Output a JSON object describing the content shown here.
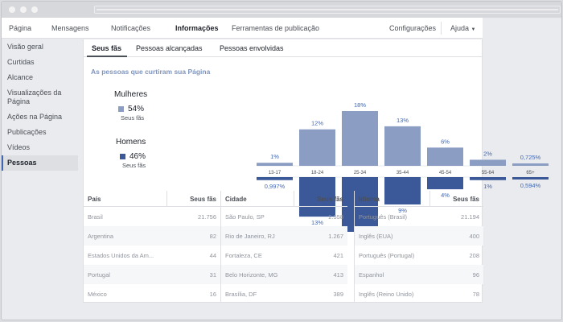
{
  "nav": {
    "items": [
      "Página",
      "Mensagens",
      "Notificações",
      "Informações",
      "Ferramentas de publicação"
    ],
    "settings": "Configurações",
    "help": "Ajuda",
    "help_caret": "▼"
  },
  "sidebar": {
    "items": [
      "Visão geral",
      "Curtidas",
      "Alcance",
      "Visualizações da Página",
      "Ações na Página",
      "Publicações",
      "Vídeos",
      "Pessoas"
    ]
  },
  "subtabs": [
    "Seus fãs",
    "Pessoas alcançadas",
    "Pessoas envolvidas"
  ],
  "subtitle": "As pessoas que curtiram sua Página",
  "legend": {
    "women": {
      "label": "Mulheres",
      "pct": "54%",
      "sub": "Seus fãs"
    },
    "men": {
      "label": "Homens",
      "pct": "46%",
      "sub": "Seus fãs"
    }
  },
  "colors": {
    "women": "#8b9dc3",
    "men": "#3b5998",
    "accent": "#4267b2"
  },
  "chart_data": {
    "type": "bar",
    "categories": [
      "13-17",
      "18-24",
      "25-34",
      "35-44",
      "45-54",
      "55-64",
      "65+"
    ],
    "series": [
      {
        "name": "Mulheres",
        "values": [
          1,
          12,
          18,
          13,
          6,
          2,
          0.725
        ],
        "labels": [
          "1%",
          "12%",
          "18%",
          "13%",
          "6%",
          "2%",
          "0,725%"
        ]
      },
      {
        "name": "Homens",
        "values": [
          0.997,
          13,
          18,
          9,
          4,
          1,
          0.594
        ],
        "labels": [
          "0,997%",
          "13%",
          "18%",
          "9%",
          "4%",
          "1%",
          "0,594%"
        ]
      }
    ],
    "ylim": [
      0,
      18
    ]
  },
  "tables": [
    {
      "headers": [
        "País",
        "Seus fãs"
      ],
      "rows": [
        [
          "Brasil",
          "21.756"
        ],
        [
          "Argentina",
          "82"
        ],
        [
          "Estados Unidos da Am...",
          "44"
        ],
        [
          "Portugal",
          "31"
        ],
        [
          "México",
          "16"
        ]
      ]
    },
    {
      "headers": [
        "Cidade",
        "Seus fãs"
      ],
      "rows": [
        [
          "São Paulo, SP",
          "2.558"
        ],
        [
          "Rio de Janeiro, RJ",
          "1.267"
        ],
        [
          "Fortaleza, CE",
          "421"
        ],
        [
          "Belo Horizonte, MG",
          "413"
        ],
        [
          "Brasília, DF",
          "389"
        ]
      ]
    },
    {
      "headers": [
        "Idioma",
        "Seus fãs"
      ],
      "rows": [
        [
          "Português (Brasil)",
          "21.194"
        ],
        [
          "Inglês (EUA)",
          "400"
        ],
        [
          "Português (Portugal)",
          "208"
        ],
        [
          "Espanhol",
          "96"
        ],
        [
          "Inglês (Reino Unido)",
          "78"
        ]
      ]
    }
  ]
}
